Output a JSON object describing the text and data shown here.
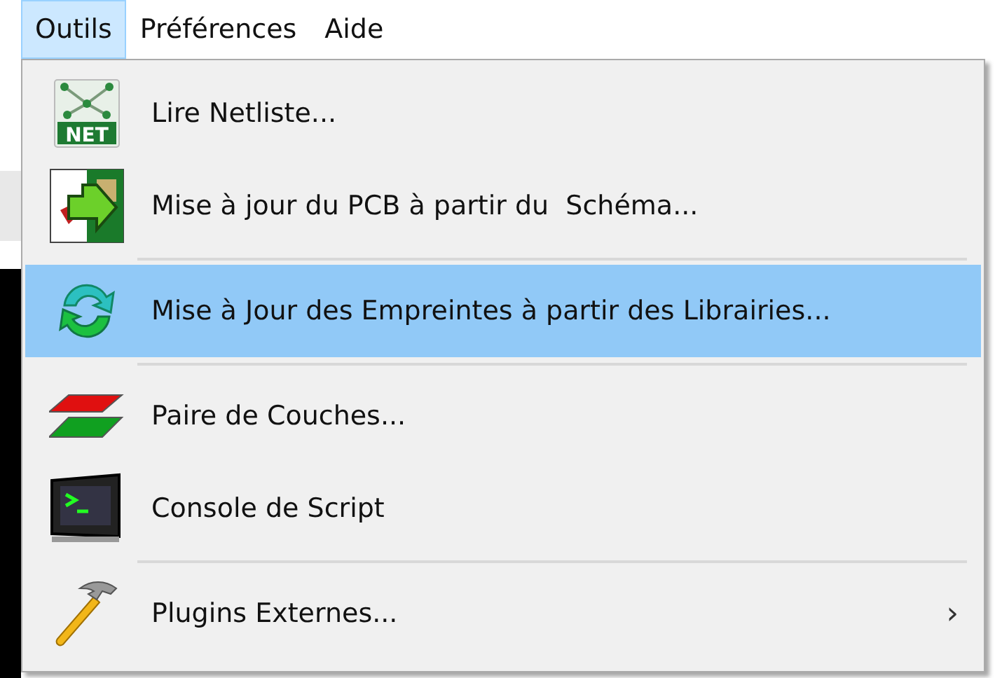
{
  "menubar": [
    {
      "label": "Outils",
      "selected": true
    },
    {
      "label": "Préférences",
      "selected": false
    },
    {
      "label": "Aide",
      "selected": false
    }
  ],
  "menu": {
    "items": [
      {
        "kind": "item",
        "label": "Lire Netliste...",
        "icon_text": "NET",
        "selected": false
      },
      {
        "kind": "item",
        "label": "Mise à jour du PCB à partir du  Schéma...",
        "selected": false
      },
      {
        "kind": "separator"
      },
      {
        "kind": "item",
        "label": "Mise à Jour des Empreintes à partir des Librairies...",
        "selected": true
      },
      {
        "kind": "separator"
      },
      {
        "kind": "item",
        "label": "Paire de Couches...",
        "selected": false
      },
      {
        "kind": "item",
        "label": "Console de Script",
        "selected": false
      },
      {
        "kind": "separator"
      },
      {
        "kind": "item",
        "label": "Plugins Externes...",
        "selected": false,
        "submenu_mark": "›"
      }
    ]
  }
}
